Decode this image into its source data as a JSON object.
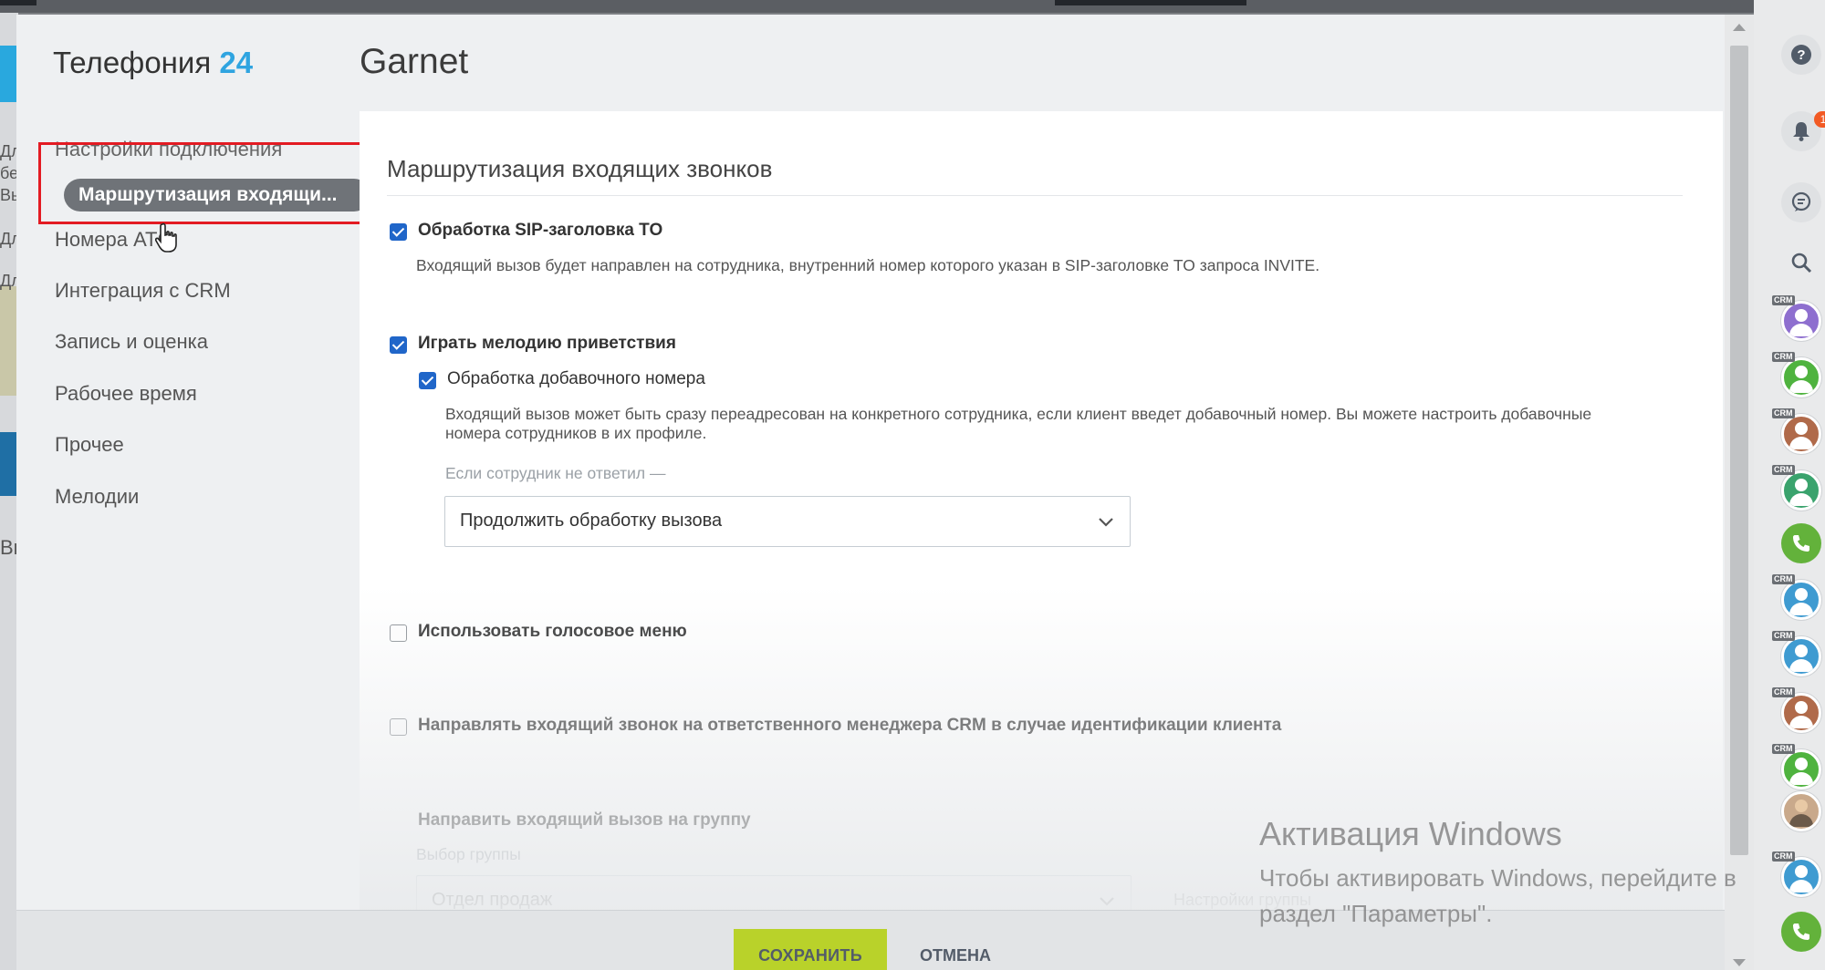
{
  "app": {
    "title_text": "Телефония",
    "title_num": "24",
    "page_title": "Garnet"
  },
  "backdrop": {
    "fragments": [
      "Дл",
      "бе",
      "Вы",
      "Дл",
      "Дл",
      "Вы"
    ]
  },
  "nav": {
    "items": [
      "Настройки подключения",
      "Маршрутизация входящи...",
      "Номера АТС",
      "Интеграция с CRM",
      "Запись и оценка",
      "Рабочее время",
      "Прочее",
      "Мелодии"
    ]
  },
  "section": {
    "title": "Маршрутизация входящих звонков"
  },
  "options": {
    "sip_header": {
      "label": "Обработка SIP-заголовка TO",
      "checked": true,
      "description": "Входящий вызов будет направлен на сотрудника, внутренний номер которого указан в SIP-заголовке TO запроса INVITE."
    },
    "greeting": {
      "label": "Играть мелодию приветствия",
      "checked": true
    },
    "extension": {
      "label": "Обработка добавочного номера",
      "checked": true,
      "description_line1": "Входящий вызов может быть сразу переадресован на конкретного сотрудника, если клиент введет добавочный номер. Вы можете настроить добавочные",
      "description_line2": "номера сотрудников в их профиле.",
      "no_answer_label": "Если сотрудник не ответил  —",
      "no_answer_value": "Продолжить обработку вызова"
    },
    "ivr": {
      "label": "Использовать голосовое меню",
      "checked": false
    },
    "crm_manager": {
      "label": "Направлять входящий звонок на ответственного менеджера CRM в случае идентификации клиента",
      "checked": false
    },
    "group": {
      "title": "Направить входящий вызов на группу",
      "select_label": "Выбор группы",
      "select_value": "Отдел продаж",
      "settings_link": "Настройки группы"
    }
  },
  "footer": {
    "save": "СОХРАНИТЬ",
    "cancel": "ОТМЕНА"
  },
  "rightbar": {
    "notification_count": "1",
    "crm_tag": "CRM",
    "avatar_colors": [
      "#8e6fcf",
      "#4fb33f",
      "#b06a4a",
      "#3aa36d",
      "#3f9bd1",
      "#3f9bd1",
      "#b06a4a",
      "#4fb33f",
      "#3f9bd1"
    ],
    "phone_color": "#63b23b"
  },
  "watermark": {
    "title": "Активация Windows",
    "line1": "Чтобы активировать Windows, перейдите в",
    "line2": "раздел \"Параметры\"."
  },
  "colors": {
    "accent_blue": "#2fa4e0",
    "checkbox_blue": "#2066c9",
    "save_green": "#b9d22a",
    "highlight_red": "#e31b23"
  }
}
